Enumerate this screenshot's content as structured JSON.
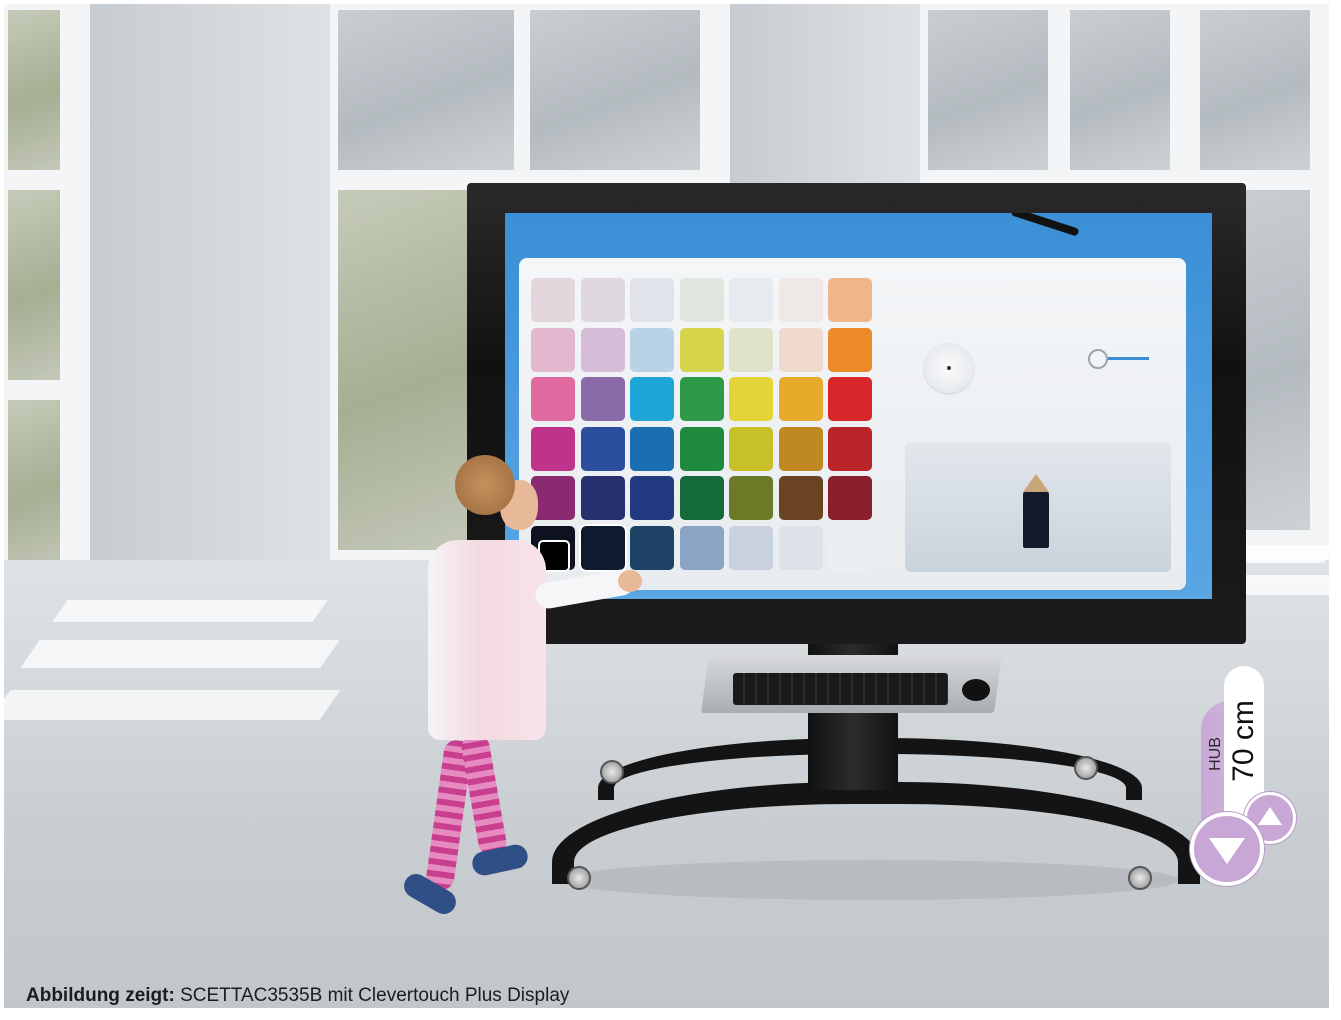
{
  "caption": {
    "label": "Abbildung zeigt:",
    "text": "SCETTAC3535B mit Clevertouch Plus Display"
  },
  "height_indicator": {
    "hub_label": "HUB",
    "value": "70 cm",
    "accent_color": "#c8a7d6",
    "up_icon": "triangle-up-icon",
    "down_icon": "triangle-down-icon"
  },
  "display_palette": {
    "rows": [
      [
        "#e3d6dc",
        "#e0d8e0",
        "#e0e4ea",
        "#e0e5df",
        "#e7eaee",
        "#eee8e6",
        "#f0b68a"
      ],
      [
        "#e3b8cf",
        "#d7bcd8",
        "#b9d2e6",
        "#d7d34a",
        "#dfe2c8",
        "#f0d8cc",
        "#ec8a2a"
      ],
      [
        "#e06a9f",
        "#8a6aa8",
        "#1ea6d8",
        "#2e9a48",
        "#e4d43a",
        "#e8aa2a",
        "#d8272a"
      ],
      [
        "#c0338a",
        "#2c4e9e",
        "#1a6eb2",
        "#1e8a3e",
        "#c8c028",
        "#c08820",
        "#b82428"
      ],
      [
        "#8a2a70",
        "#26306e",
        "#223a80",
        "#146a3a",
        "#6a7a26",
        "#6a4422",
        "#8a1e2a"
      ],
      [
        "#0e1220",
        "#0e1a30",
        "#1e4266",
        "#8aa4c4",
        "#c8d2de",
        "#dde2e8",
        "#eceff2"
      ]
    ],
    "selected": [
      5,
      1
    ]
  }
}
